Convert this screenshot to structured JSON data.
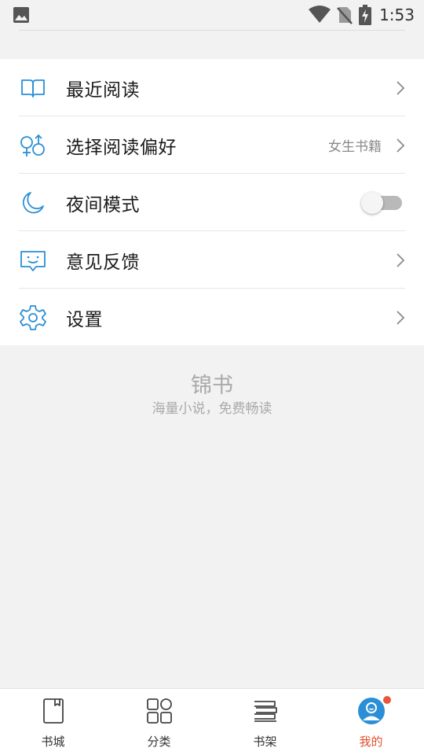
{
  "status_bar": {
    "time": "1:53",
    "icons": [
      "gallery-icon",
      "wifi-icon",
      "no-sim-icon",
      "battery-charging-icon"
    ]
  },
  "menu": {
    "items": [
      {
        "label": "最近阅读",
        "icon": "book-open-icon",
        "trailing": "chevron"
      },
      {
        "label": "选择阅读偏好",
        "value": "女生书籍",
        "icon": "gender-icon",
        "trailing": "chevron"
      },
      {
        "label": "夜间模式",
        "icon": "moon-icon",
        "trailing": "toggle",
        "toggle_on": false
      },
      {
        "label": "意见反馈",
        "icon": "feedback-icon",
        "trailing": "chevron"
      },
      {
        "label": "设置",
        "icon": "gear-icon",
        "trailing": "chevron"
      }
    ]
  },
  "brand": {
    "name": "锦书",
    "slogan": "海量小说，免费畅读"
  },
  "bottom_nav": {
    "items": [
      {
        "label": "书城",
        "icon": "book-icon",
        "active": false
      },
      {
        "label": "分类",
        "icon": "grid-icon",
        "active": false
      },
      {
        "label": "书架",
        "icon": "bookshelf-icon",
        "active": false
      },
      {
        "label": "我的",
        "icon": "profile-icon",
        "active": true,
        "badge": true
      }
    ]
  },
  "colors": {
    "accent_icon": "#2a8fd6",
    "active_tab": "#e0522e",
    "badge": "#e8573a",
    "background": "#f2f2f2"
  }
}
